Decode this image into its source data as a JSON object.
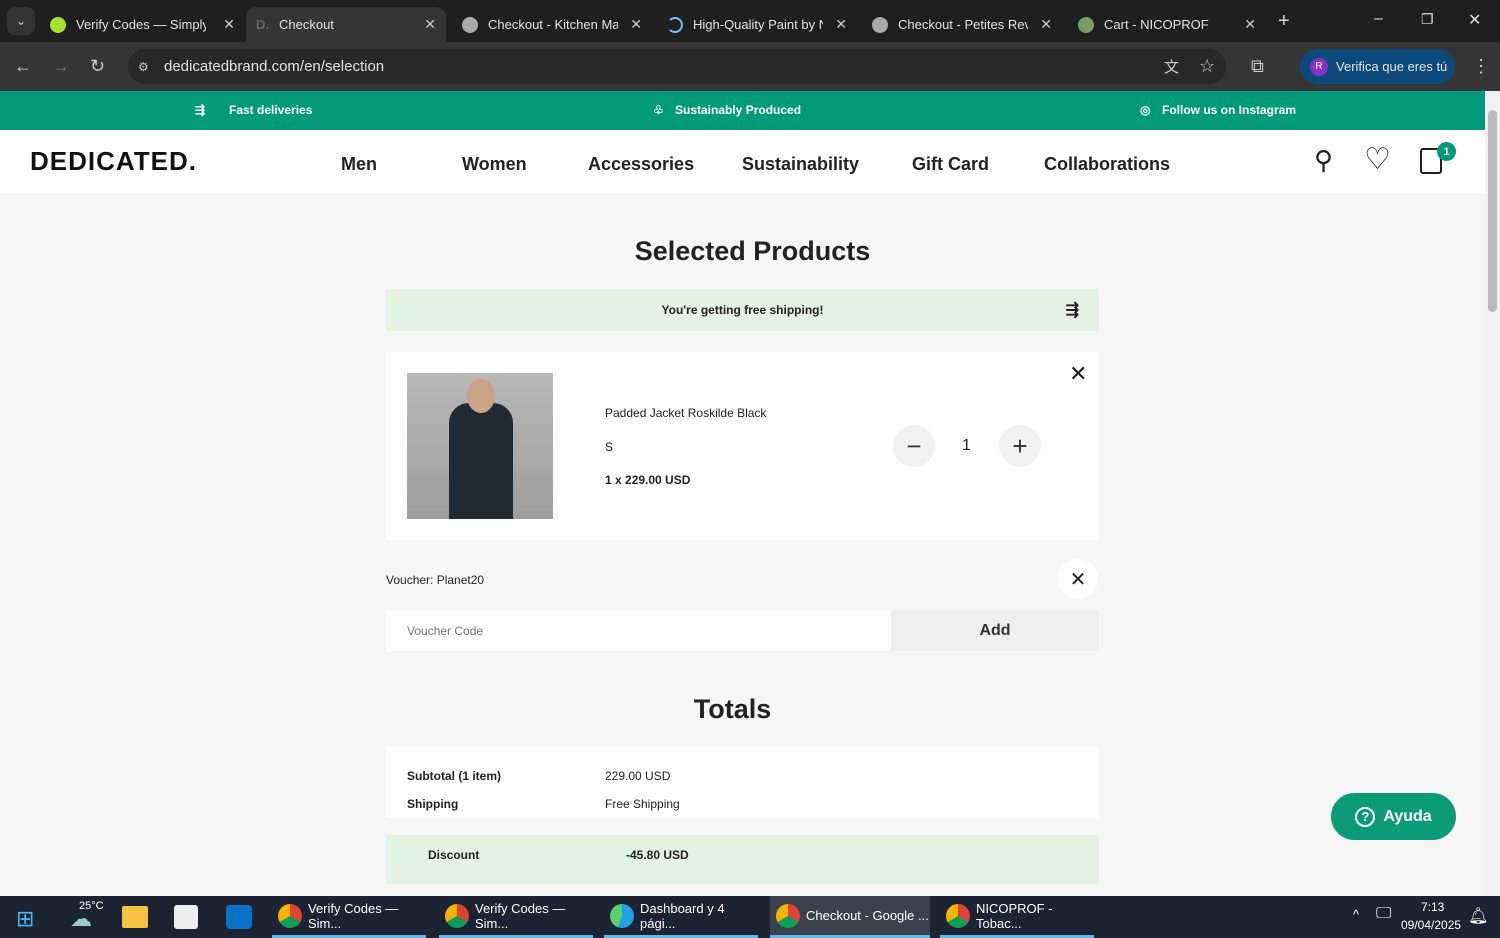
{
  "browser": {
    "tabs": [
      {
        "title": "Verify Codes — SimplyCodes"
      },
      {
        "title": "Checkout",
        "active": true
      },
      {
        "title": "Checkout - Kitchen Man"
      },
      {
        "title": "High-Quality Paint by N"
      },
      {
        "title": "Checkout - Petites Reve"
      },
      {
        "title": "Cart - NICOPROF"
      }
    ],
    "url": "dedicatedbrand.com/en/selection",
    "profile_label": "Verifica que eres tú",
    "profile_initial": "R"
  },
  "promo": {
    "items": [
      "Fast deliveries",
      "Sustainably Produced",
      "Follow us on Instagram"
    ]
  },
  "header": {
    "logo": "DEDICATED.",
    "nav": [
      "Men",
      "Women",
      "Accessories",
      "Sustainability",
      "Gift Card",
      "Collaborations"
    ],
    "cart_count": "1"
  },
  "cart": {
    "title": "Selected Products",
    "shipping_banner": "You're getting free shipping!",
    "item": {
      "name": "Padded Jacket Roskilde Black",
      "size": "S",
      "price": "1 x 229.00 USD",
      "quantity": "1"
    },
    "voucher_label": "Voucher: Planet20",
    "voucher_placeholder": "Voucher Code",
    "add_label": "Add"
  },
  "totals": {
    "title": "Totals",
    "subtotal_label": "Subtotal (1 item)",
    "subtotal": "229.00 USD",
    "shipping_label": "Shipping",
    "shipping": "Free Shipping",
    "discount_label": "Discount",
    "discount": "-45.80 USD"
  },
  "help": {
    "label": "Ayuda"
  },
  "taskbar": {
    "weather": "25°C",
    "apps": [
      "Verify Codes — Sim...",
      "Verify Codes — Sim...",
      "Dashboard y 4 pági...",
      "Checkout - Google ...",
      "NICOPROF - Tobac..."
    ],
    "time": "7:13",
    "date": "09/04/2025"
  }
}
